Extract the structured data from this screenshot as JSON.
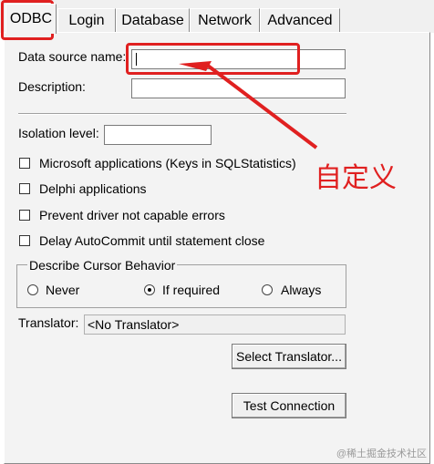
{
  "tabs": [
    {
      "label": "ODBC",
      "active": true
    },
    {
      "label": "Login",
      "active": false
    },
    {
      "label": "Database",
      "active": false
    },
    {
      "label": "Network",
      "active": false
    },
    {
      "label": "Advanced",
      "active": false
    }
  ],
  "form": {
    "data_source_name_label": "Data source name:",
    "data_source_name_value": "",
    "description_label": "Description:",
    "description_value": "",
    "isolation_level_label": "Isolation level:",
    "isolation_level_value": ""
  },
  "checkboxes": [
    {
      "label": "Microsoft applications (Keys in SQLStatistics)",
      "checked": false
    },
    {
      "label": "Delphi applications",
      "checked": false
    },
    {
      "label": "Prevent driver not capable errors",
      "checked": false
    },
    {
      "label": "Delay AutoCommit until statement close",
      "checked": false
    }
  ],
  "cursor_group": {
    "title": "Describe Cursor Behavior",
    "options": [
      {
        "label": "Never",
        "selected": false
      },
      {
        "label": "If required",
        "selected": true
      },
      {
        "label": "Always",
        "selected": false
      }
    ]
  },
  "translator": {
    "label": "Translator:",
    "value": "<No Translator>",
    "select_button": "Select Translator..."
  },
  "test_connection_button": "Test Connection",
  "annotation": {
    "text": "自定义",
    "color": "#e02020"
  },
  "watermark": "@稀土掘金技术社区"
}
